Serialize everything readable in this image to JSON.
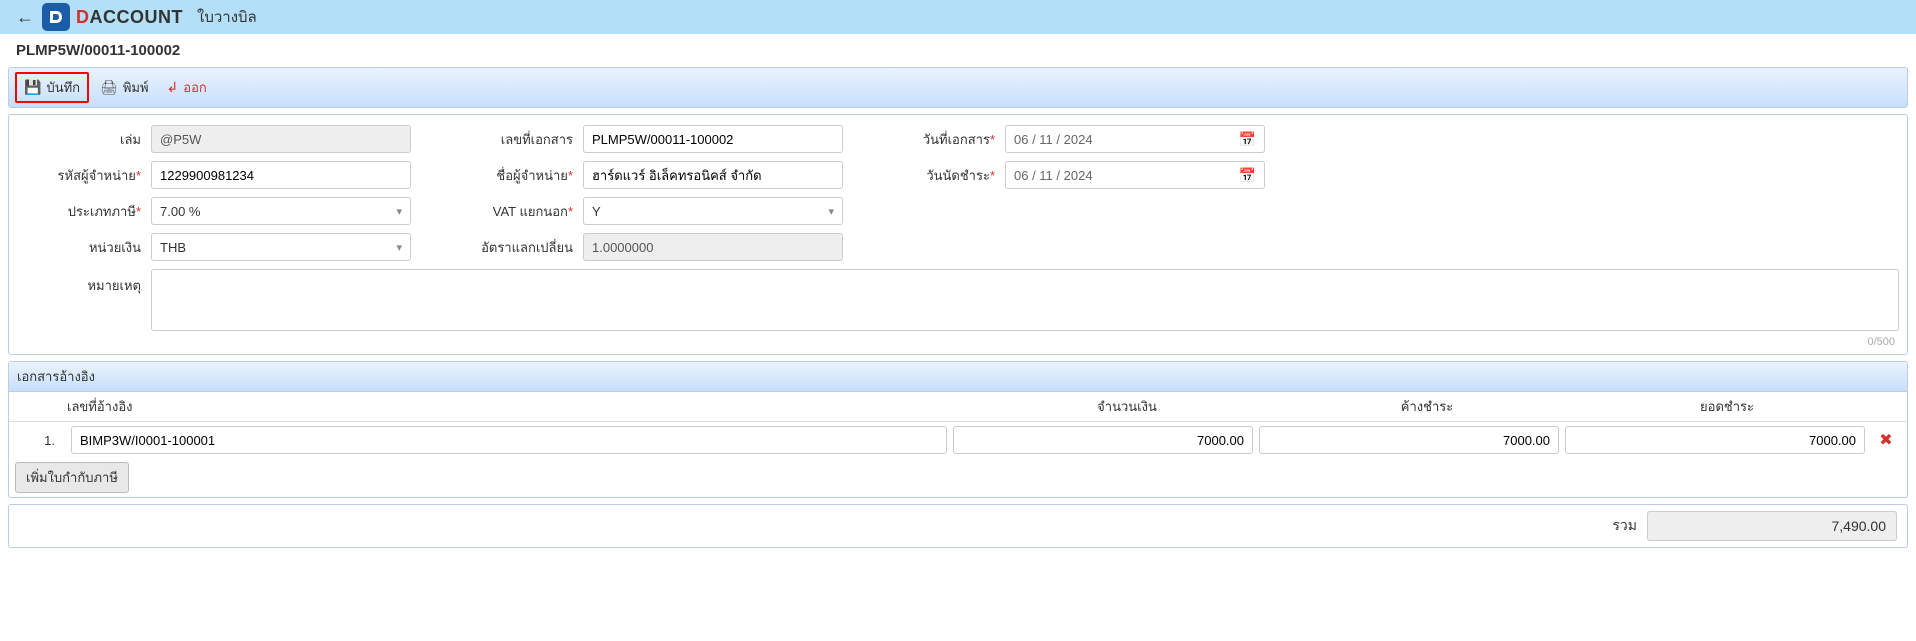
{
  "header": {
    "brand_prefix": "D",
    "brand_rest": "ACCOUNT",
    "page_title": "ใบวางบิล"
  },
  "doc_no": "PLMP5W/00011-100002",
  "toolbar": {
    "save": "บันทึก",
    "print": "พิมพ์",
    "exit": "ออก"
  },
  "form": {
    "book_label": "เล่ม",
    "book": "@P5W",
    "docno_label": "เลขที่เอกสาร",
    "docno": "PLMP5W/00011-100002",
    "docdate_label": "วันที่เอกสาร",
    "docdate": "06 / 11 /  2024",
    "vendor_code_label": "รหัสผู้จำหน่าย",
    "vendor_code": "1229900981234",
    "vendor_name_label": "ชื่อผู้จำหน่าย",
    "vendor_name": "ฮาร์ดแวร์ อิเล็คทรอนิคส์ จำกัด",
    "due_label": "วันนัดชำระ",
    "due": "06 / 11 /  2024",
    "tax_type_label": "ประเภทภาษี",
    "tax_type": "7.00 %",
    "vat_sep_label": "VAT แยกนอก",
    "vat_sep": "Y",
    "currency_label": "หน่วยเงิน",
    "currency": "THB",
    "exrate_label": "อัตราแลกเปลี่ยน",
    "exrate": "1.0000000",
    "remark_label": "หมายเหตุ",
    "remark": "",
    "char_count": "0/500"
  },
  "ref": {
    "section_title": "เอกสารอ้างอิง",
    "col_refno": "เลขที่อ้างอิง",
    "col_amount": "จำนวนเงิน",
    "col_outstanding": "ค้างชำระ",
    "col_pay": "ยอดชำระ",
    "rows": [
      {
        "idx": "1.",
        "refno": "BIMP3W/I0001-100001",
        "amount": "7000.00",
        "outstanding": "7000.00",
        "pay": "7000.00"
      }
    ],
    "add_btn": "เพิ่มใบกำกับภาษี"
  },
  "total": {
    "label": "รวม",
    "value": "7,490.00"
  }
}
